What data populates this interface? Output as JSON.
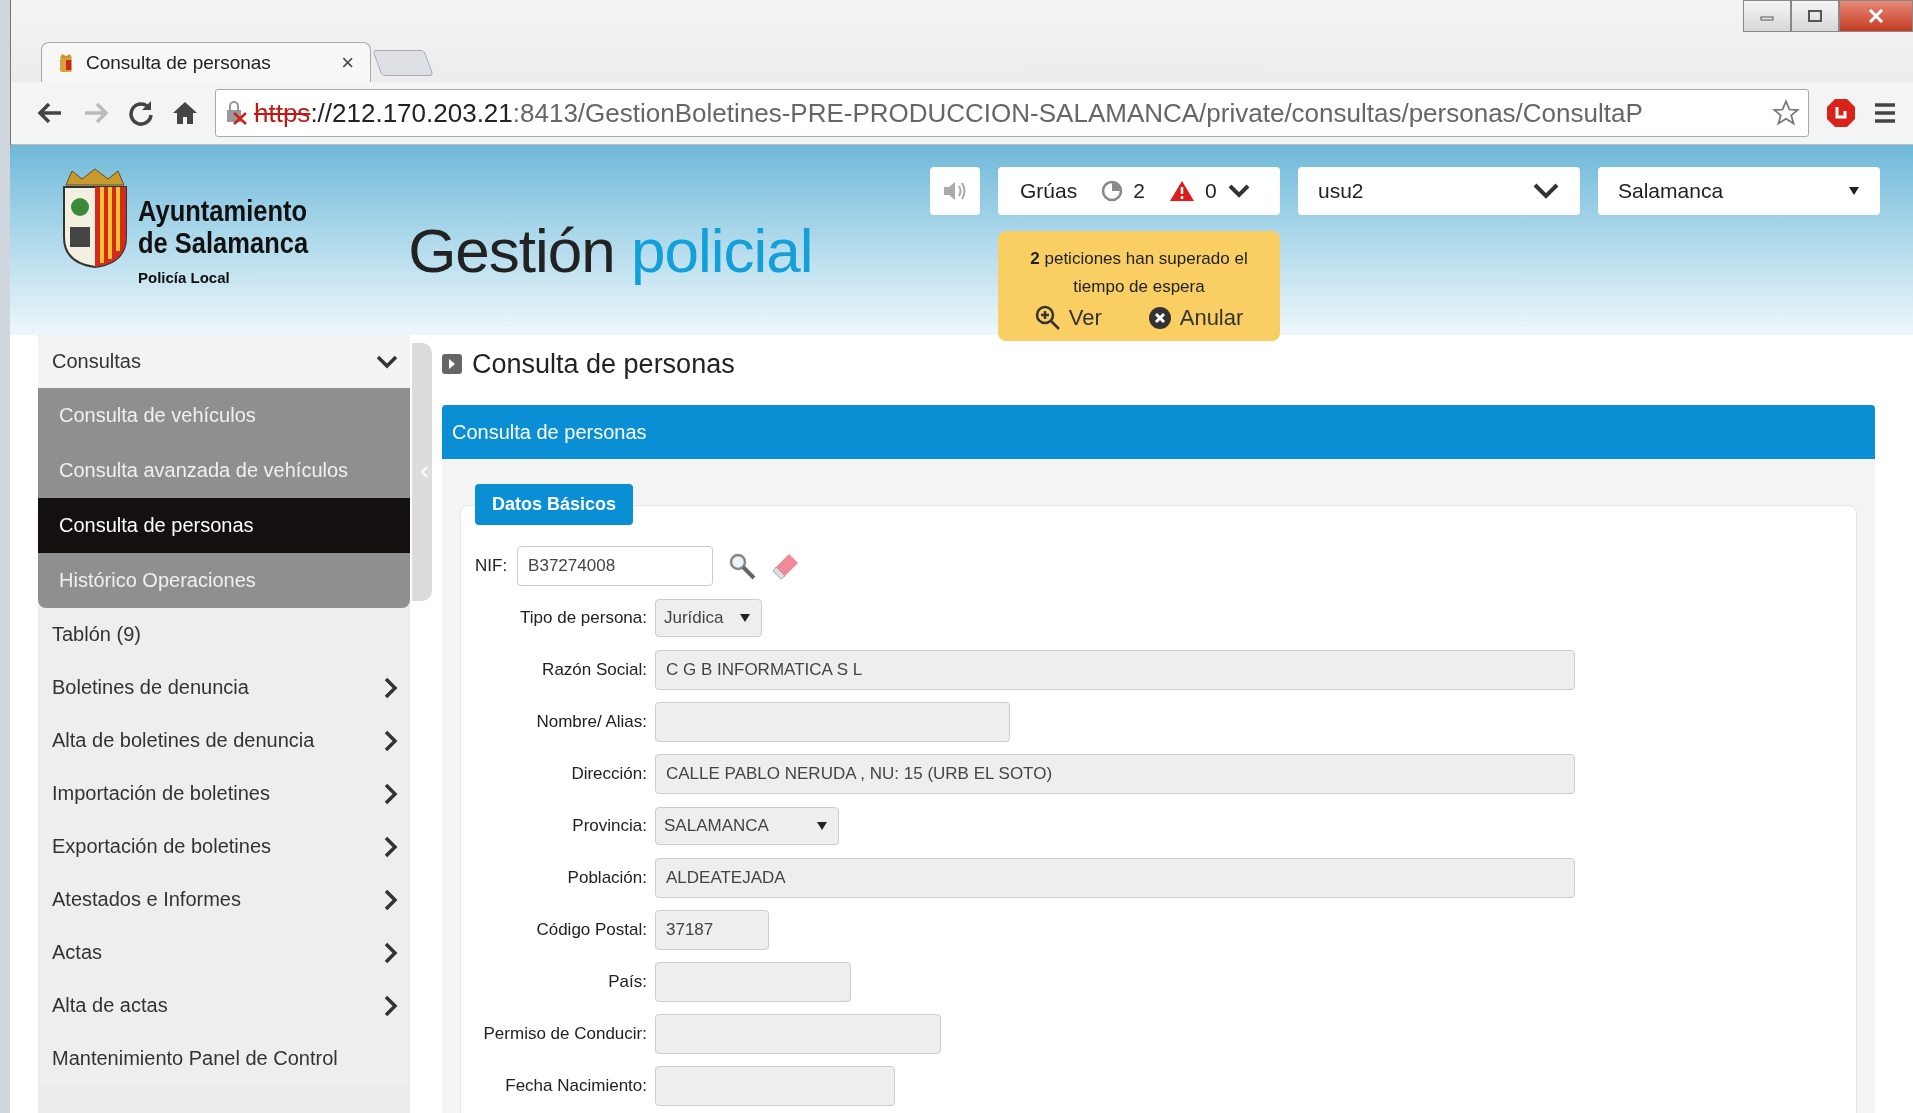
{
  "browser": {
    "tab": {
      "title": "Consulta de personas",
      "close": "×"
    },
    "url": {
      "scheme": "https",
      "host": "://212.170.203.21",
      "path": ":8413/GestionBoletines-PRE-PRODUCCION-SALAMANCA/private/consultas/personas/ConsultaP"
    },
    "forward_disabled": true
  },
  "header": {
    "org_line1": "Ayuntamiento",
    "org_line2": "de Salamanca",
    "org_sub": "Policía Local",
    "app_title_1": "Gestión",
    "app_title_2": "policial",
    "cranes": {
      "label": "Grúas",
      "pending": "2",
      "alerts": "0"
    },
    "user": {
      "value": "usu2"
    },
    "city": {
      "value": "Salamanca"
    },
    "notice": {
      "text": "**2** peticiones han superado el tiempo de espera",
      "view": "Ver",
      "cancel": "Anular"
    }
  },
  "sidebar": {
    "items": [
      {
        "label": "Consultas",
        "submenu": true,
        "expanded": true,
        "children": [
          {
            "label": "Consulta de vehículos",
            "selected": false
          },
          {
            "label": "Consulta avanzada de vehículos",
            "selected": false
          },
          {
            "label": "Consulta de personas",
            "selected": true
          },
          {
            "label": "Histórico Operaciones",
            "selected": false
          }
        ]
      },
      {
        "label": "Tablón (9)",
        "submenu": false
      },
      {
        "label": "Boletines de denuncia",
        "submenu": true,
        "expanded": false
      },
      {
        "label": "Alta de boletines de denuncia",
        "submenu": true,
        "expanded": false
      },
      {
        "label": "Importación de boletines",
        "submenu": true,
        "expanded": false
      },
      {
        "label": "Exportación de boletines",
        "submenu": true,
        "expanded": false
      },
      {
        "label": "Atestados e Informes",
        "submenu": true,
        "expanded": false
      },
      {
        "label": "Actas",
        "submenu": true,
        "expanded": false
      },
      {
        "label": "Alta de actas",
        "submenu": true,
        "expanded": false
      },
      {
        "label": "Mantenimiento Panel de Control",
        "submenu": false
      }
    ]
  },
  "main": {
    "page_title": "Consulta de personas",
    "panel_title": "Consulta de personas",
    "section_tab": "Datos Básicos",
    "fields": [
      {
        "kind": "search",
        "label": "NIF:",
        "value": "B37274008"
      },
      {
        "kind": "select",
        "label": "Tipo de persona:",
        "value": "Jurídica"
      },
      {
        "kind": "text",
        "label": "Razón Social:",
        "value": "C G B INFORMATICA S L"
      },
      {
        "kind": "text",
        "label": "Nombre/ Alias:"
      },
      {
        "kind": "text",
        "label": "Dirección:",
        "value": "CALLE PABLO NERUDA , NU: 15 (URB EL SOTO)"
      },
      {
        "kind": "select",
        "label": "Provincia:",
        "value": "SALAMANCA"
      },
      {
        "kind": "text",
        "label": "Población:",
        "value": "ALDEATEJADA"
      },
      {
        "kind": "text",
        "label": "Código Postal:",
        "value": "37187"
      },
      {
        "kind": "text",
        "label": "País:"
      },
      {
        "kind": "text",
        "label": "Permiso de Conducir:"
      },
      {
        "kind": "text",
        "label": "Fecha Nacimiento:"
      }
    ]
  }
}
